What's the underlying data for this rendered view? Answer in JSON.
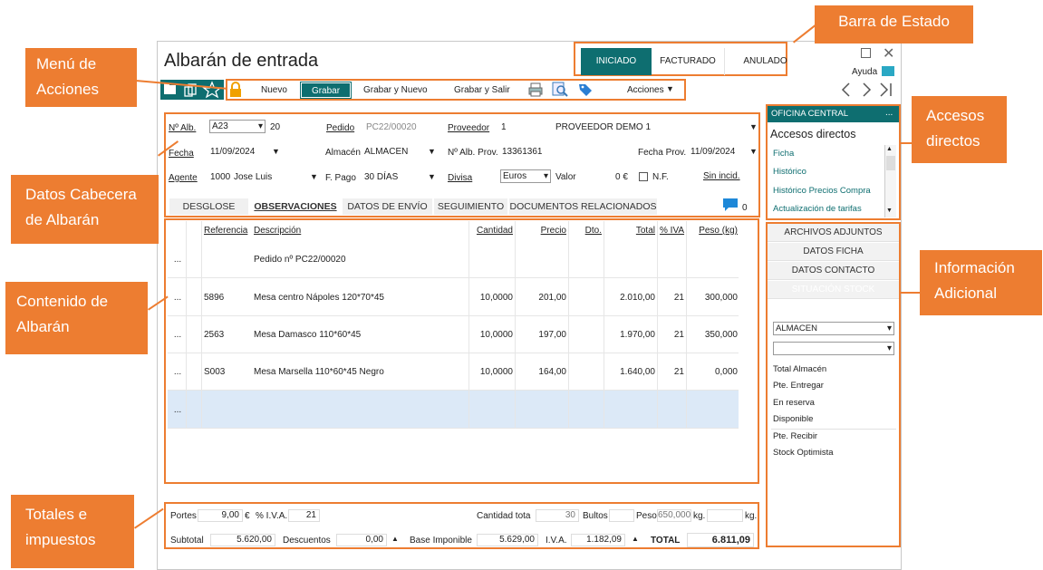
{
  "window": {
    "title": "Albarán de entrada",
    "help_label": "Ayuda"
  },
  "status_bar": {
    "items": [
      "INICIADO",
      "FACTURADO",
      "ANULADO"
    ],
    "active": "INICIADO"
  },
  "toolbar": {
    "new_label": "Nuevo",
    "save_label": "Grabar",
    "save_new_label": "Grabar y Nuevo",
    "save_exit_label": "Grabar y Salir",
    "actions_label": "Acciones"
  },
  "header": {
    "num_alb_label": "Nº Alb.",
    "num_alb_series": "A23",
    "num_alb_value": "20",
    "pedido_label": "Pedido",
    "pedido_value": "PC22/00020",
    "proveedor_label": "Proveedor",
    "proveedor_code": "1",
    "proveedor_name": "PROVEEDOR DEMO 1",
    "fecha_label": "Fecha",
    "fecha_value": "11/09/2024",
    "almacen_label": "Almacén",
    "almacen_value": "ALMACEN",
    "num_alb_prov_label": "Nº Alb. Prov.",
    "num_alb_prov_value": "13361361",
    "fecha_prov_label": "Fecha Prov.",
    "fecha_prov_value": "11/09/2024",
    "agente_label": "Agente",
    "agente_code": "1000",
    "agente_name": "Jose Luis",
    "fpago_label": "F. Pago",
    "fpago_value": "30 DÍAS",
    "divisa_label": "Divisa",
    "divisa_value": "Euros",
    "valor_label": "Valor",
    "valor_value": "0 €",
    "nf_label": "N.F.",
    "sin_incid_label": "Sin incid."
  },
  "tabs": [
    "DESGLOSE",
    "OBSERVACIONES",
    "DATOS DE ENVÍO",
    "SEGUIMIENTO",
    "DOCUMENTOS RELACIONADOS"
  ],
  "comments_count": "0",
  "table": {
    "columns": [
      "Referencia",
      "Descripción",
      "Cantidad",
      "Precio",
      "Dto.",
      "Total",
      "% IVA",
      "Peso (kg)"
    ],
    "rows": [
      {
        "menu": "...",
        "ref": "",
        "desc": "Pedido nº PC22/00020",
        "qty": "",
        "price": "",
        "dto": "",
        "total": "",
        "iva": "",
        "peso": ""
      },
      {
        "menu": "...",
        "ref": "5896",
        "desc": "Mesa centro Nápoles 120*70*45",
        "qty": "10,0000",
        "price": "201,00",
        "dto": "",
        "total": "2.010,00",
        "iva": "21",
        "peso": "300,000"
      },
      {
        "menu": "...",
        "ref": "2563",
        "desc": "Mesa Damasco 110*60*45",
        "qty": "10,0000",
        "price": "197,00",
        "dto": "",
        "total": "1.970,00",
        "iva": "21",
        "peso": "350,000"
      },
      {
        "menu": "...",
        "ref": "S003",
        "desc": "Mesa Marsella 110*60*45 Negro",
        "qty": "10,0000",
        "price": "164,00",
        "dto": "",
        "total": "1.640,00",
        "iva": "21",
        "peso": "0,000"
      },
      {
        "menu": "...",
        "ref": "",
        "desc": "",
        "qty": "",
        "price": "",
        "dto": "",
        "total": "",
        "iva": "",
        "peso": ""
      }
    ]
  },
  "totals": {
    "portes_label": "Portes",
    "portes_value": "9,00",
    "portes_currency": "€",
    "iva_pct_label": "% I.V.A.",
    "iva_pct_value": "21",
    "cantidad_label": "Cantidad tota",
    "cantidad_value": "30",
    "bultos_label": "Bultos",
    "peso_label": "Peso",
    "peso_value": "650,000",
    "peso_unit_a": "kg.",
    "peso_unit_b": "kg.",
    "subtotal_label": "Subtotal",
    "subtotal_value": "5.620,00",
    "descuentos_label": "Descuentos",
    "descuentos_value": "0,00",
    "base_label": "Base Imponible",
    "base_value": "5.629,00",
    "iva_label": "I.V.A.",
    "iva_value": "1.182,09",
    "total_label": "TOTAL",
    "total_value": "6.811,09"
  },
  "sidebar": {
    "office": "OFICINA CENTRAL",
    "office_more": "...",
    "shortcuts_title": "Accesos directos",
    "shortcuts": [
      "Ficha",
      "Histórico",
      "Histórico Precios Compra",
      "Actualización de tarifas"
    ],
    "sections": [
      "ARCHIVOS ADJUNTOS",
      "DATOS FICHA",
      "DATOS CONTACTO",
      "SITUACIÓN STOCK"
    ],
    "stock_warehouse": "ALMACEN",
    "stock_items": [
      "Total Almacén",
      "Pte. Entregar",
      "En reserva",
      "Disponible",
      "Pte. Recibir",
      "Stock Optimista"
    ]
  },
  "callouts": {
    "estado": "Barra de Estado",
    "menu": "Menú de Acciones",
    "accesos": "Accesos directos",
    "cabecera": "Datos Cabecera de Albarán",
    "contenido": "Contenido de Albarán",
    "info": "Información Adicional",
    "totales": "Totales e impuestos"
  },
  "colors": {
    "accent": "#0e6e70",
    "callout": "#ed7d31",
    "selected_row": "#dce9f7"
  }
}
